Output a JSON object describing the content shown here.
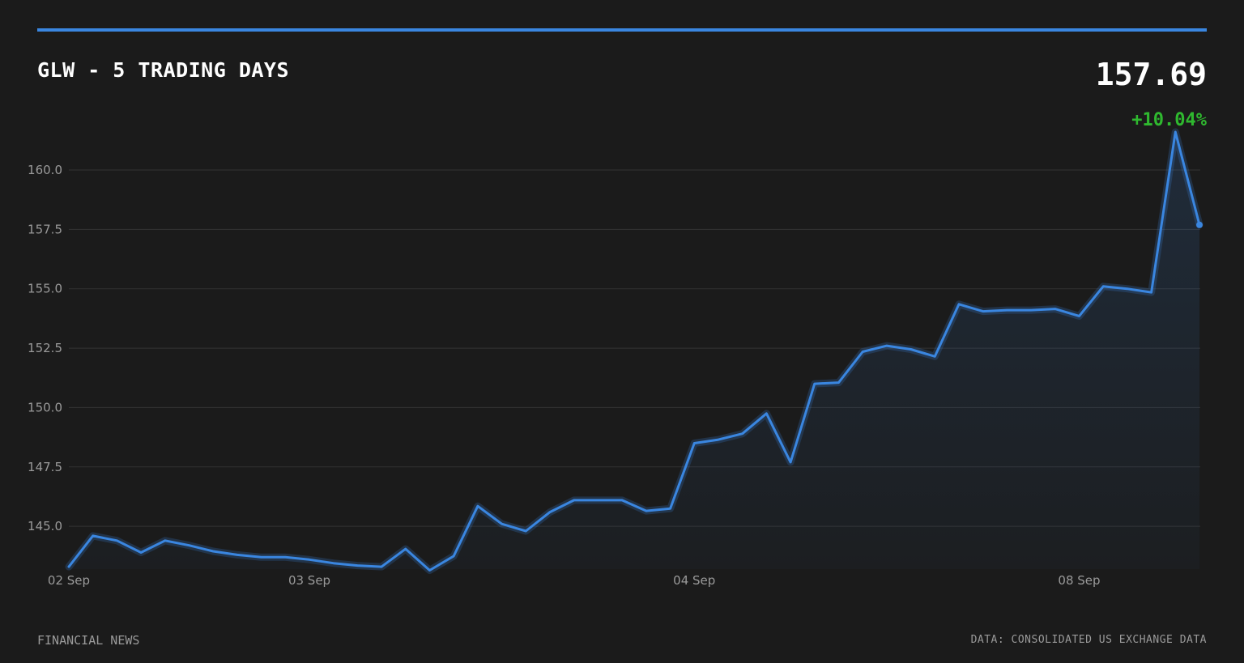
{
  "header": {
    "title": "GLW - 5 TRADING DAYS",
    "price": "157.69",
    "change": "+10.04%"
  },
  "footer": {
    "source_left": "FINANCIAL NEWS",
    "source_right": "DATA: CONSOLIDATED US EXCHANGE DATA"
  },
  "colors": {
    "background": "#1b1b1b",
    "line": "#3a86e0",
    "positive": "#2fb82f",
    "grid": "#333333",
    "tick_text": "#9a9a9a"
  },
  "chart_data": {
    "type": "area",
    "title": "GLW - 5 TRADING DAYS",
    "xlabel": "",
    "ylabel": "",
    "ylim": [
      143.2,
      161.6
    ],
    "yticks": [
      145.0,
      147.5,
      150.0,
      152.5,
      155.0,
      157.5,
      160.0
    ],
    "ytick_labels": [
      "145.0",
      "147.5",
      "150.0",
      "152.5",
      "155.0",
      "157.5",
      "160.0"
    ],
    "xtick_labels": [
      {
        "label": "02 Sep",
        "index": 0
      },
      {
        "label": "03 Sep",
        "index": 10
      },
      {
        "label": "04 Sep",
        "index": 26
      },
      {
        "label": "08 Sep",
        "index": 42
      }
    ],
    "grid": true,
    "series": [
      {
        "values": [
          143.3,
          144.6,
          144.4,
          143.9,
          144.4,
          144.2,
          143.95,
          143.8,
          143.7,
          143.7,
          143.6,
          143.45,
          143.35,
          143.3,
          144.05,
          143.15,
          143.75,
          145.85,
          145.1,
          144.8,
          145.6,
          146.1,
          146.1,
          146.1,
          145.65,
          145.75,
          148.5,
          148.65,
          148.9,
          149.75,
          147.7,
          151.0,
          151.05,
          152.35,
          152.6,
          152.45,
          152.15,
          154.35,
          154.05,
          154.1,
          154.1,
          154.15,
          153.85,
          155.1,
          155.0,
          154.85,
          161.6,
          157.69
        ]
      }
    ]
  }
}
